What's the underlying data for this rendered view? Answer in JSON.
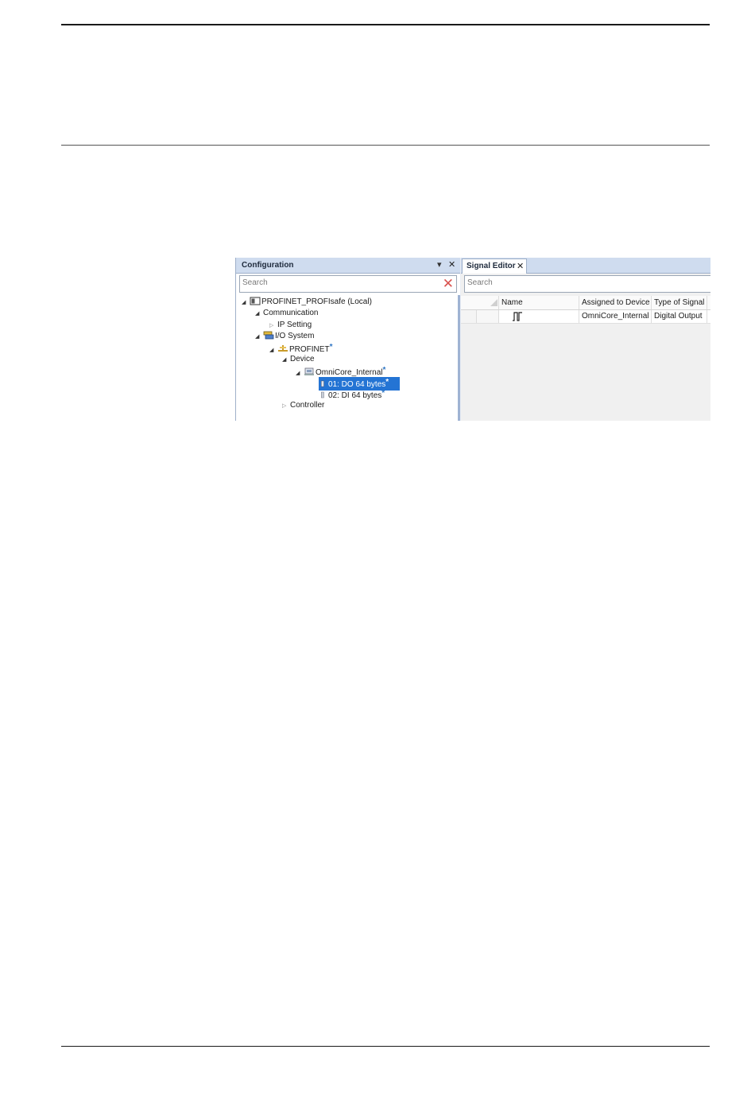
{
  "configuration": {
    "title": "Configuration",
    "pin_glyph": "▾",
    "close_glyph": "✕",
    "search_placeholder": "Search",
    "clear_glyph": "✕",
    "tree": [
      {
        "label": "PROFINET_PROFIsafe (Local)",
        "icon": "controller-icon",
        "state": "open"
      },
      {
        "label": "Communication",
        "state": "open"
      },
      {
        "label": "IP Setting",
        "state": "closed"
      },
      {
        "label": "I/O System",
        "icon": "io-system-icon",
        "state": "open"
      },
      {
        "label": "PROFINET",
        "icon": "network-icon",
        "state": "open",
        "star": "*"
      },
      {
        "label": "Device",
        "state": "open"
      },
      {
        "label": "OmniCore_Internal",
        "icon": "device-icon",
        "state": "open",
        "star": "*"
      },
      {
        "label": "01: DO 64 bytes",
        "icon": "module-icon",
        "selected": true,
        "star": "*"
      },
      {
        "label": "02: DI 64 bytes",
        "icon": "module-icon",
        "star": "*"
      },
      {
        "label": "Controller",
        "state": "closed"
      }
    ]
  },
  "signal_editor": {
    "title": "Signal Editor",
    "close_glyph": "✕",
    "search_placeholder": "Search",
    "columns": [
      "Name",
      "Assigned to Device",
      "Type of Signal"
    ],
    "rows": [
      {
        "name_icon": "pulse-signal-icon",
        "assigned_to_device": "OmniCore_Internal",
        "type_of_signal": "Digital Output"
      }
    ]
  },
  "colors": {
    "selection": "#2474d4",
    "panel_header": "#cfdcef",
    "star": "#2f76c4",
    "clear": "#d9534f"
  }
}
